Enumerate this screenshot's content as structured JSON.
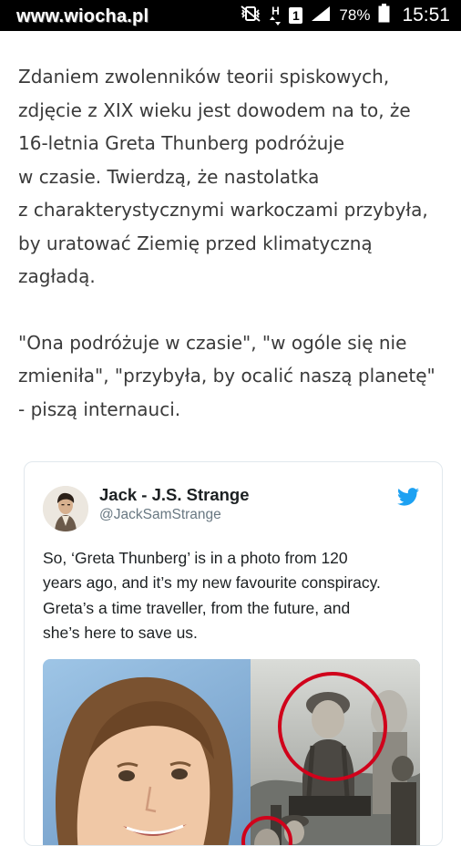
{
  "watermark": "www.wiocha.pl",
  "status_bar": {
    "network_label": "H",
    "sim_label": "1",
    "battery": "78%",
    "time": "15:51",
    "icons": [
      "mute-vibrate-icon",
      "data-arrows-icon",
      "sim-icon",
      "signal-icon",
      "battery-icon"
    ]
  },
  "article": {
    "paragraph_1": [
      "Zdaniem zwolenników teorii spiskowych,",
      "zdjęcie z XIX wieku jest dowodem na to, że",
      "16-letnia Greta Thunberg podróżuje",
      "w czasie. Twierdzą, że nastolatka",
      "z charakterystycznymi warkoczami przybyła,",
      "by uratować Ziemię przed klimatyczną",
      "zagładą."
    ],
    "paragraph_2": [
      "\"Ona podróżuje w czasie\", \"w ogóle się nie",
      "zmieniła\", \"przybyła, by ocalić naszą planetę\"",
      "- piszą internauci."
    ]
  },
  "tweet": {
    "author_name": "Jack - J.S. Strange",
    "author_handle": "@JackSamStrange",
    "text_lines": [
      "So, ‘Greta Thunberg’ is in a photo from 120",
      "years ago, and it’s my new favourite conspiracy.",
      "Greta’s a time traveller, from the future, and",
      "she’s here to save us."
    ],
    "brand_color": "#1da1f2",
    "highlight_color": "#d0021b"
  }
}
